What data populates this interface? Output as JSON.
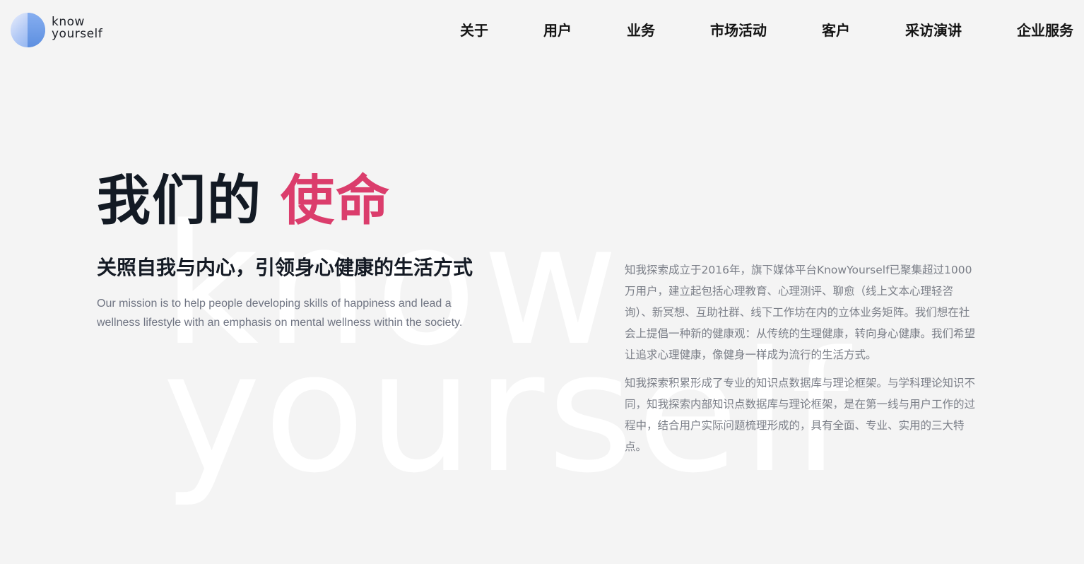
{
  "logo": {
    "alt": "know yourself",
    "word_line1": "know",
    "word_line2": "yourself"
  },
  "nav": {
    "items": [
      {
        "label": "关于"
      },
      {
        "label": "用户"
      },
      {
        "label": "业务"
      },
      {
        "label": "市场活动"
      },
      {
        "label": "客户"
      },
      {
        "label": "采访演讲"
      },
      {
        "label": "企业服务"
      }
    ]
  },
  "watermark": {
    "line1": "know",
    "line2": "yourself"
  },
  "mission": {
    "title_main": "我们的",
    "title_accent": "使命",
    "subtitle": "关照自我与内心，引领身心健康的生活方式",
    "description_en": "Our mission is to help people developing skills of happiness and lead a wellness lifestyle with an emphasis on mental wellness within the society."
  },
  "about": {
    "paragraphs": [
      "知我探索成立于2016年，旗下媒体平台KnowYourself已聚集超过1000万用户，建立起包括心理教育、心理测评、聊愈（线上文本心理轻咨询）、新冥想、互助社群、线下工作坊在内的立体业务矩阵。我们想在社会上提倡一种新的健康观：从传统的生理健康，转向身心健康。我们希望让追求心理健康，像健身一样成为流行的生活方式。",
      "知我探索积累形成了专业的知识点数据库与理论框架。与学科理论知识不同，知我探索内部知识点数据库与理论框架，是在第一线与用户工作的过程中，结合用户实际问题梳理形成的，具有全面、专业、实用的三大特点。"
    ]
  },
  "colors": {
    "background": "#f4f4f4",
    "accent": "#db3d6c",
    "heading": "#131a24",
    "body_text": "#7b7f88",
    "logo_blue": "#7aa5ec"
  }
}
